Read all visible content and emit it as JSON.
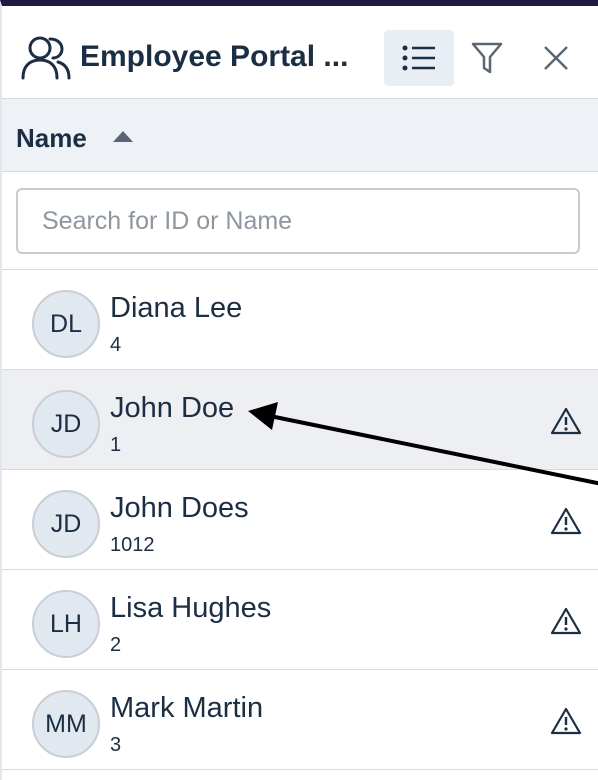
{
  "header": {
    "title": "Employee Portal ...",
    "icons": {
      "app": "users-icon",
      "list": "list-icon",
      "filter": "filter-icon",
      "close": "close-icon"
    }
  },
  "column": {
    "label": "Name",
    "sort": "ascending"
  },
  "search": {
    "placeholder": "Search for ID or Name",
    "value": ""
  },
  "employees": [
    {
      "initials": "DL",
      "name": "Diana Lee",
      "id": "4",
      "warning": false,
      "selected": false
    },
    {
      "initials": "JD",
      "name": "John Doe",
      "id": "1",
      "warning": true,
      "selected": true
    },
    {
      "initials": "JD",
      "name": "John Does",
      "id": "1012",
      "warning": true,
      "selected": false
    },
    {
      "initials": "LH",
      "name": "Lisa Hughes",
      "id": "2",
      "warning": true,
      "selected": false
    },
    {
      "initials": "MM",
      "name": "Mark Martin",
      "id": "3",
      "warning": true,
      "selected": false
    }
  ],
  "colors": {
    "accent": "#1d1b46",
    "text": "#1c2e44",
    "header_bg": "#eef1f6",
    "selected_bg": "#edeff2"
  }
}
